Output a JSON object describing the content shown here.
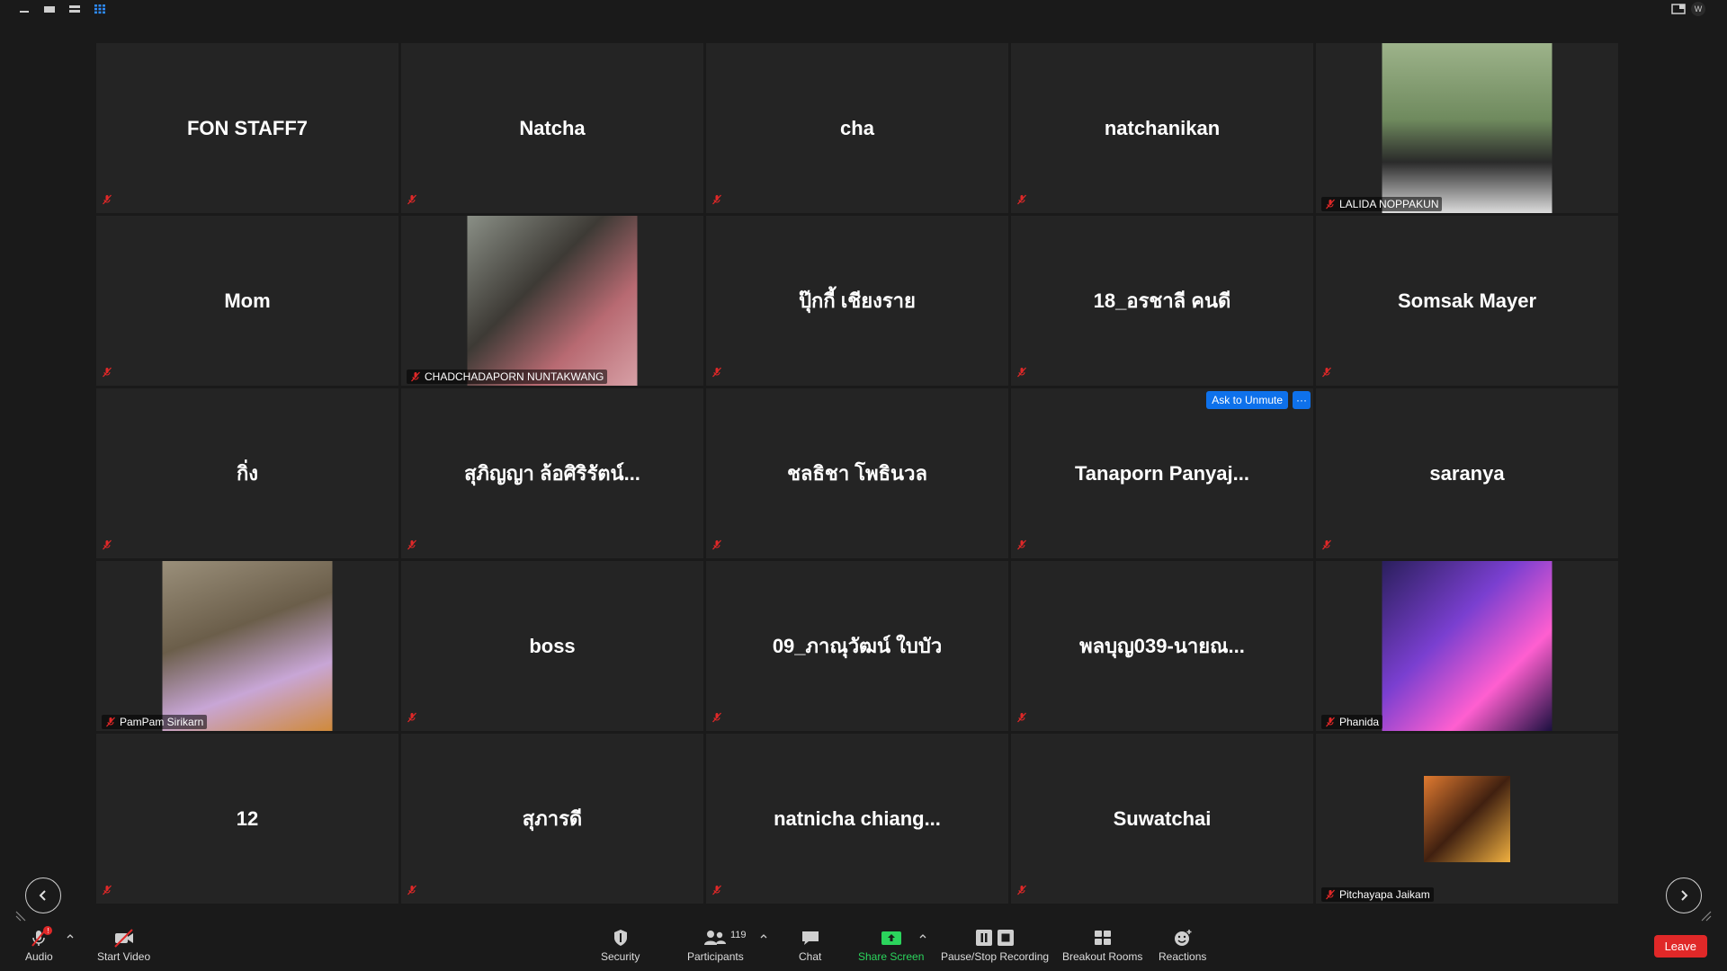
{
  "top": {
    "user_initial": "W"
  },
  "tiles": [
    {
      "name": "FON STAFF7",
      "video": false
    },
    {
      "name": "Natcha",
      "video": false
    },
    {
      "name": "cha",
      "video": false
    },
    {
      "name": "natchanikan",
      "video": false
    },
    {
      "name": "LALIDA NOPPAKUN",
      "video": true
    },
    {
      "name": "Mom",
      "video": false
    },
    {
      "name": "CHADCHADAPORN NUNTAKWANG",
      "video": true
    },
    {
      "name": "ปุ๊กกี้ เชียงราย",
      "video": false
    },
    {
      "name": "18_อรชาลี คนดี",
      "video": false
    },
    {
      "name": "Somsak Mayer",
      "video": false
    },
    {
      "name": "กิ่ง",
      "video": false
    },
    {
      "name": "สุภิญญา ล้อศิริรัตน์...",
      "video": false
    },
    {
      "name": "ชลธิชา โพธินวล",
      "video": false
    },
    {
      "name": "Tanaporn  Panyaj...",
      "video": false
    },
    {
      "name": "saranya",
      "video": false
    },
    {
      "name": "PamPam Sirikarn",
      "video": true
    },
    {
      "name": "boss",
      "video": false
    },
    {
      "name": "09_ภาณุวัฒน์ ใบบัว",
      "video": false
    },
    {
      "name": "พลบุญ039-นายณ...",
      "video": false
    },
    {
      "name": "Phanida",
      "video": true
    },
    {
      "name": "12",
      "video": false
    },
    {
      "name": "สุภารดี",
      "video": false
    },
    {
      "name": "natnicha  chiang...",
      "video": false
    },
    {
      "name": "Suwatchai",
      "video": false
    },
    {
      "name": "Pitchayapa Jaikam",
      "video": true
    }
  ],
  "tile_actions": {
    "ask_unmute": "Ask to Unmute",
    "more": "···"
  },
  "toolbar": {
    "audio": "Audio",
    "audio_badge": "!",
    "start_video": "Start Video",
    "security": "Security",
    "participants": "Participants",
    "participants_count": "119",
    "chat": "Chat",
    "share_screen": "Share Screen",
    "recording": "Pause/Stop Recording",
    "breakout": "Breakout Rooms",
    "reactions": "Reactions",
    "leave": "Leave"
  },
  "colors": {
    "accent": "#0e71eb",
    "leave": "#e02828",
    "share": "#2bd45c",
    "tile_bg": "#242424",
    "bg": "#1a1a1a"
  }
}
